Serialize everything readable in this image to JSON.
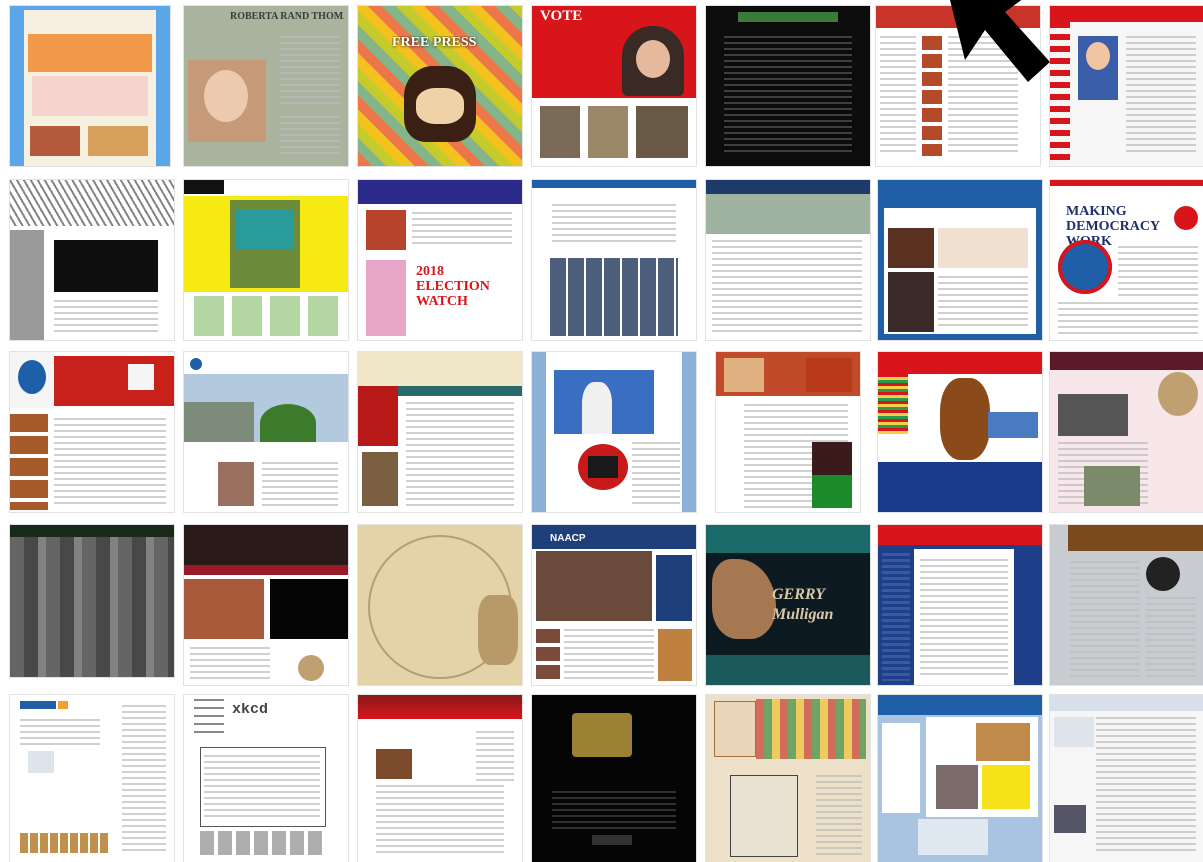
{
  "screen": {
    "name": "Website screenshot collage",
    "visible_text": [
      "ROBERTA RAND THOMAS",
      "FREE PRESS",
      "VOTE",
      "MAKING DEMOCRACY WORK",
      "2018 ELECTION WATCH",
      "NAACP",
      "GERRY Mulligan",
      "xkcd"
    ]
  },
  "thumbnails": [
    {
      "id": "r1c1",
      "label": ""
    },
    {
      "id": "r1c2",
      "label": "ROBERTA RAND THOMAS"
    },
    {
      "id": "r1c3",
      "label": "FREE PRESS"
    },
    {
      "id": "r1c4",
      "label": "VOTE"
    },
    {
      "id": "r1c5",
      "label": ""
    },
    {
      "id": "r1c6",
      "label": ""
    },
    {
      "id": "r1c7",
      "label": ""
    },
    {
      "id": "r2c1",
      "label": ""
    },
    {
      "id": "r2c2",
      "label": ""
    },
    {
      "id": "r2c3",
      "label": "2018 ELECTION WATCH"
    },
    {
      "id": "r2c4",
      "label": ""
    },
    {
      "id": "r2c5",
      "label": ""
    },
    {
      "id": "r2c6",
      "label": ""
    },
    {
      "id": "r2c7",
      "label": "MAKING DEMOCRACY WORK"
    },
    {
      "id": "r3c1",
      "label": ""
    },
    {
      "id": "r3c2",
      "label": ""
    },
    {
      "id": "r3c3",
      "label": ""
    },
    {
      "id": "r3c4",
      "label": ""
    },
    {
      "id": "r3c5",
      "label": ""
    },
    {
      "id": "r3c6",
      "label": ""
    },
    {
      "id": "r3c7",
      "label": ""
    },
    {
      "id": "r4c1",
      "label": ""
    },
    {
      "id": "r4c2",
      "label": ""
    },
    {
      "id": "r4c3",
      "label": ""
    },
    {
      "id": "r4c4",
      "label": "NAACP"
    },
    {
      "id": "r4c5",
      "label": "GERRY Mulligan"
    },
    {
      "id": "r4c6",
      "label": ""
    },
    {
      "id": "r4c7",
      "label": ""
    },
    {
      "id": "r5c1",
      "label": ""
    },
    {
      "id": "r5c2",
      "label": "xkcd"
    },
    {
      "id": "r5c3",
      "label": ""
    },
    {
      "id": "r5c4",
      "label": ""
    },
    {
      "id": "r5c5",
      "label": ""
    },
    {
      "id": "r5c6",
      "label": ""
    },
    {
      "id": "r5c7",
      "label": ""
    }
  ],
  "colors": {
    "accent_red": "#d8151a",
    "accent_blue": "#1f5fa8",
    "dark": "#111111",
    "cursor": "#000000"
  },
  "cursor": {
    "icon": "mouse-pointer-icon"
  }
}
